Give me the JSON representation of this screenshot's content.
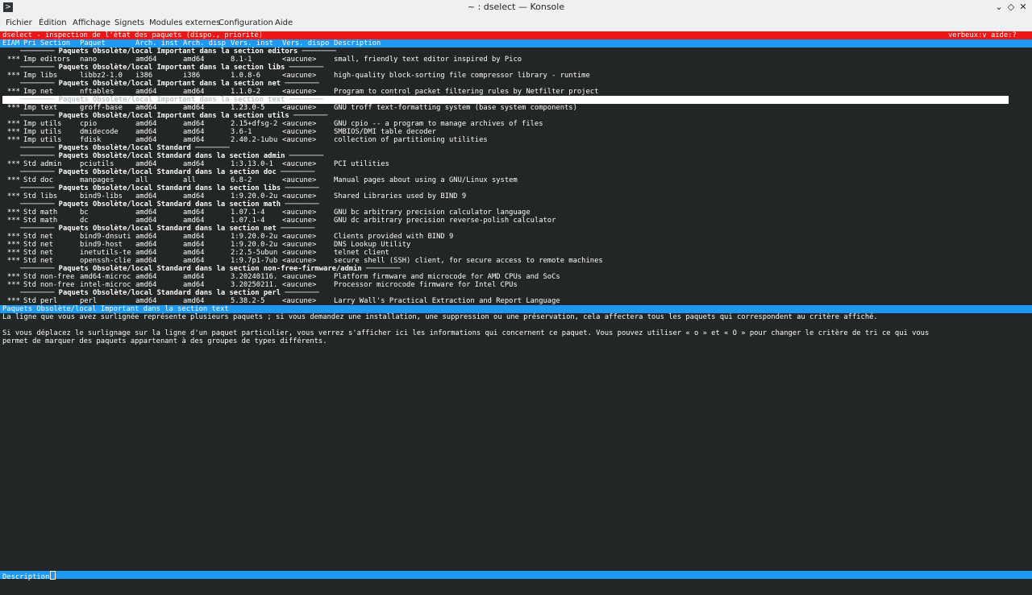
{
  "window": {
    "title": "~ : dselect — Konsole",
    "app_icon": "terminal-icon"
  },
  "menubar": [
    "Fichier",
    "Édition",
    "Affichage",
    "Signets",
    "Modules externes",
    "Configuration",
    "Aide"
  ],
  "dselect": {
    "title": "dselect - inspection de l'état des paquets (dispo., priorité)",
    "title_right": "verbeux:v aide:?",
    "columns": {
      "eiam": "EIAM",
      "pri": "Pri",
      "section": "Section",
      "package": "Paquet",
      "arch_inst": "Arch. inst",
      "arch_disp": "Arch. disp",
      "vers_inst": "Vers. inst",
      "vers_dispo": "Vers. dispo",
      "description": "Description"
    },
    "rows": [
      {
        "type": "header",
        "text": "──────── Paquets Obsolète/local Important dans la section editors ────────"
      },
      {
        "type": "pkg",
        "eiam": "***",
        "pri": "Imp",
        "section": "editors",
        "package": "nano",
        "arch_inst": "amd64",
        "arch_disp": "amd64",
        "vers_inst": "8.1-1",
        "vers_dispo": "<aucune>",
        "description": "small, friendly text editor inspired by Pico"
      },
      {
        "type": "header",
        "text": "──────── Paquets Obsolète/local Important dans la section libs ────────"
      },
      {
        "type": "pkg",
        "eiam": "***",
        "pri": "Imp",
        "section": "libs",
        "package": "libbz2-1.0",
        "arch_inst": "i386",
        "arch_disp": "i386",
        "vers_inst": "1.0.8-6",
        "vers_dispo": "<aucune>",
        "description": "high-quality block-sorting file compressor library - runtime"
      },
      {
        "type": "header",
        "text": "──────── Paquets Obsolète/local Important dans la section net ────────"
      },
      {
        "type": "pkg",
        "eiam": "***",
        "pri": "Imp",
        "section": "net",
        "package": "nftables",
        "arch_inst": "amd64",
        "arch_disp": "amd64",
        "vers_inst": "1.1.0-2",
        "vers_dispo": "<aucune>",
        "description": "Program to control packet filtering rules by Netfilter project"
      },
      {
        "type": "header",
        "selected": true,
        "text": "──────── Paquets Obsolète/local Important dans la section text ────────"
      },
      {
        "type": "pkg",
        "eiam": "***",
        "pri": "Imp",
        "section": "text",
        "package": "groff-base",
        "arch_inst": "amd64",
        "arch_disp": "amd64",
        "vers_inst": "1.23.0-5",
        "vers_dispo": "<aucune>",
        "description": "GNU troff text-formatting system (base system components)"
      },
      {
        "type": "header",
        "text": "──────── Paquets Obsolète/local Important dans la section utils ────────"
      },
      {
        "type": "pkg",
        "eiam": "***",
        "pri": "Imp",
        "section": "utils",
        "package": "cpio",
        "arch_inst": "amd64",
        "arch_disp": "amd64",
        "vers_inst": "2.15+dfsg-2",
        "vers_dispo": "<aucune>",
        "description": "GNU cpio -- a program to manage archives of files"
      },
      {
        "type": "pkg",
        "eiam": "***",
        "pri": "Imp",
        "section": "utils",
        "package": "dmidecode",
        "arch_inst": "amd64",
        "arch_disp": "amd64",
        "vers_inst": "3.6-1",
        "vers_dispo": "<aucune>",
        "description": "SMBIOS/DMI table decoder"
      },
      {
        "type": "pkg",
        "eiam": "***",
        "pri": "Imp",
        "section": "utils",
        "package": "fdisk",
        "arch_inst": "amd64",
        "arch_disp": "amd64",
        "vers_inst": "2.40.2-1ubu",
        "vers_dispo": "<aucune>",
        "description": "collection of partitioning utilities"
      },
      {
        "type": "header",
        "indent": "short",
        "text": "──────── Paquets Obsolète/local Standard ────────"
      },
      {
        "type": "header",
        "text": "──────── Paquets Obsolète/local Standard dans la section admin ────────"
      },
      {
        "type": "pkg",
        "eiam": "***",
        "pri": "Std",
        "section": "admin",
        "package": "pciutils",
        "arch_inst": "amd64",
        "arch_disp": "amd64",
        "vers_inst": "1:3.13.0-1",
        "vers_dispo": "<aucune>",
        "description": "PCI utilities"
      },
      {
        "type": "header",
        "text": "──────── Paquets Obsolète/local Standard dans la section doc ────────"
      },
      {
        "type": "pkg",
        "eiam": "***",
        "pri": "Std",
        "section": "doc",
        "package": "manpages",
        "arch_inst": "all",
        "arch_disp": "all",
        "vers_inst": "6.8-2",
        "vers_dispo": "<aucune>",
        "description": "Manual pages about using a GNU/Linux system"
      },
      {
        "type": "header",
        "text": "──────── Paquets Obsolète/local Standard dans la section libs ────────"
      },
      {
        "type": "pkg",
        "eiam": "***",
        "pri": "Std",
        "section": "libs",
        "package": "bind9-libs",
        "arch_inst": "amd64",
        "arch_disp": "amd64",
        "vers_inst": "1:9.20.0-2u",
        "vers_dispo": "<aucune>",
        "description": "Shared Libraries used by BIND 9"
      },
      {
        "type": "header",
        "text": "──────── Paquets Obsolète/local Standard dans la section math ────────"
      },
      {
        "type": "pkg",
        "eiam": "***",
        "pri": "Std",
        "section": "math",
        "package": "bc",
        "arch_inst": "amd64",
        "arch_disp": "amd64",
        "vers_inst": "1.07.1-4",
        "vers_dispo": "<aucune>",
        "description": "GNU bc arbitrary precision calculator language"
      },
      {
        "type": "pkg",
        "eiam": "***",
        "pri": "Std",
        "section": "math",
        "package": "dc",
        "arch_inst": "amd64",
        "arch_disp": "amd64",
        "vers_inst": "1.07.1-4",
        "vers_dispo": "<aucune>",
        "description": "GNU dc arbitrary precision reverse-polish calculator"
      },
      {
        "type": "header",
        "text": "──────── Paquets Obsolète/local Standard dans la section net ────────"
      },
      {
        "type": "pkg",
        "eiam": "***",
        "pri": "Std",
        "section": "net",
        "package": "bind9-dnsuti",
        "arch_inst": "amd64",
        "arch_disp": "amd64",
        "vers_inst": "1:9.20.0-2u",
        "vers_dispo": "<aucune>",
        "description": "Clients provided with BIND 9"
      },
      {
        "type": "pkg",
        "eiam": "***",
        "pri": "Std",
        "section": "net",
        "package": "bind9-host",
        "arch_inst": "amd64",
        "arch_disp": "amd64",
        "vers_inst": "1:9.20.0-2u",
        "vers_dispo": "<aucune>",
        "description": "DNS Lookup Utility"
      },
      {
        "type": "pkg",
        "eiam": "***",
        "pri": "Std",
        "section": "net",
        "package": "inetutils-te",
        "arch_inst": "amd64",
        "arch_disp": "amd64",
        "vers_inst": "2:2.5-5ubun",
        "vers_dispo": "<aucune>",
        "description": "telnet client"
      },
      {
        "type": "pkg",
        "eiam": "***",
        "pri": "Std",
        "section": "net",
        "package": "openssh-clie",
        "arch_inst": "amd64",
        "arch_disp": "amd64",
        "vers_inst": "1:9.7p1-7ub",
        "vers_dispo": "<aucune>",
        "description": "secure shell (SSH) client, for secure access to remote machines"
      },
      {
        "type": "header",
        "text": "──────── Paquets Obsolète/local Standard dans la section non-free-firmware/admin ────────"
      },
      {
        "type": "pkg",
        "eiam": "***",
        "pri": "Std",
        "section": "non-free",
        "package": "amd64-microc",
        "arch_inst": "amd64",
        "arch_disp": "amd64",
        "vers_inst": "3.20240116.",
        "vers_dispo": "<aucune>",
        "description": "Platform firmware and microcode for AMD CPUs and SoCs"
      },
      {
        "type": "pkg",
        "eiam": "***",
        "pri": "Std",
        "section": "non-free",
        "package": "intel-microc",
        "arch_inst": "amd64",
        "arch_disp": "amd64",
        "vers_inst": "3.20250211.",
        "vers_dispo": "<aucune>",
        "description": "Processor microcode firmware for Intel CPUs"
      },
      {
        "type": "header",
        "text": "──────── Paquets Obsolète/local Standard dans la section perl ────────"
      },
      {
        "type": "pkg",
        "eiam": "***",
        "pri": "Std",
        "section": "perl",
        "package": "perl",
        "arch_inst": "amd64",
        "arch_disp": "amd64",
        "vers_inst": "5.38.2-5",
        "vers_dispo": "<aucune>",
        "description": "Larry Wall's Practical Extraction and Report Language"
      }
    ],
    "info_title": "Paquets Obsolète/local Important dans la section text",
    "info_lines": [
      "La ligne que vous avez surlignée représente plusieurs paquets ; si vous demandez une installation, une suppression ou une préservation, cela affectera tous les paquets qui correspondent au critère affiché.",
      "",
      "Si vous déplacez le surlignage sur la ligne d'un paquet particulier, vous verrez s'afficher ici les informations qui concernent ce paquet. Vous pouvez utiliser « o » et « O » pour changer le critère de tri ce qui vous",
      "permet de marquer des paquets appartenant à des groupes de types différents."
    ],
    "status": "Description"
  },
  "colors": {
    "terminal_bg": "#232627",
    "title_bar_red": "#ed1515",
    "header_blue": "#1d99f3",
    "selection": "#ffffff"
  }
}
